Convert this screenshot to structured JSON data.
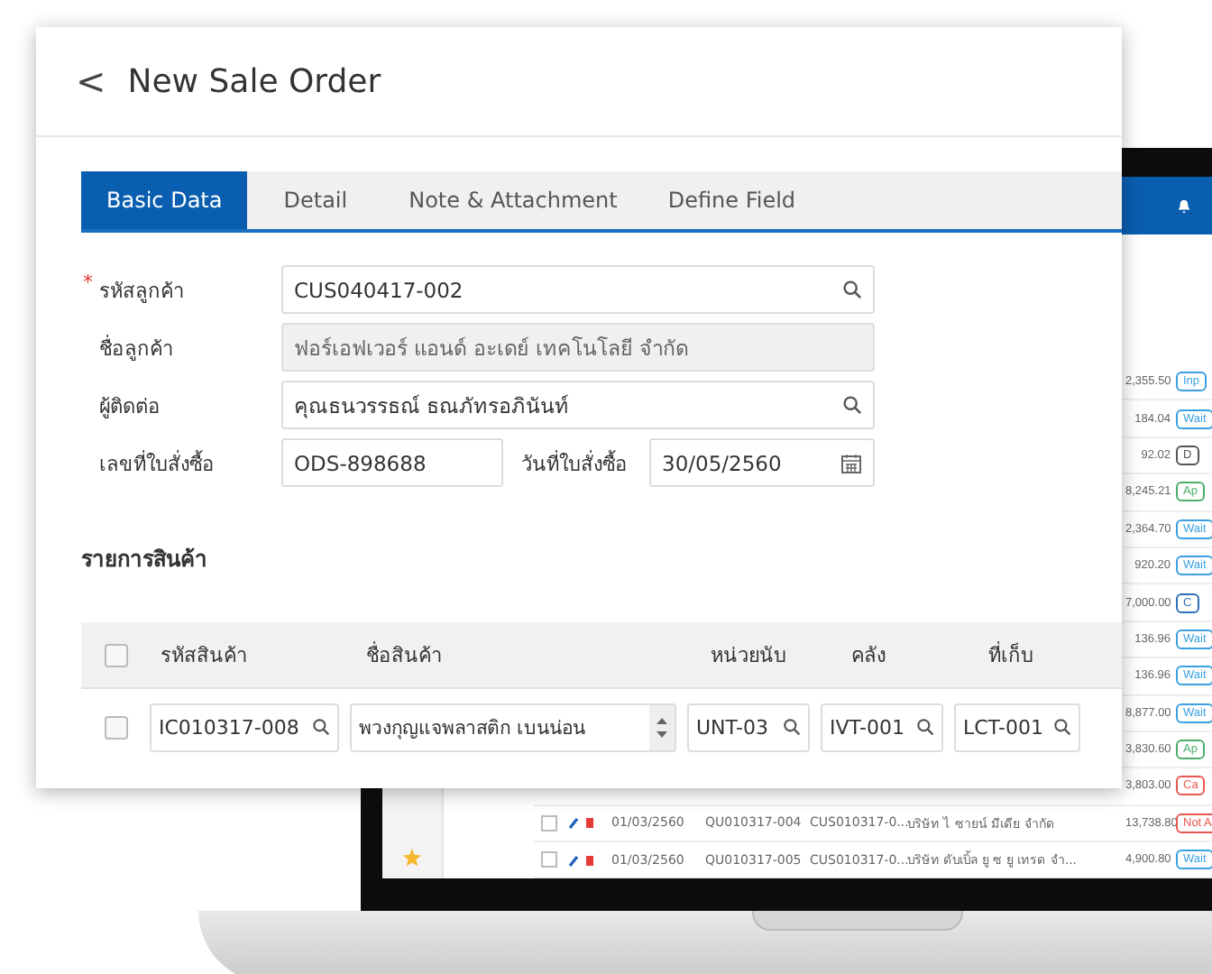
{
  "dialog": {
    "back": "<",
    "required_mark": "*",
    "title": "New Sale Order",
    "tabs": [
      {
        "label": "Basic Data",
        "selected": true
      },
      {
        "label": "Detail",
        "selected": false
      },
      {
        "label": "Note & Attachment",
        "selected": false
      },
      {
        "label": "Define Field",
        "selected": false
      }
    ],
    "fields": [
      {
        "label": "รหัสลูกค้า",
        "required": true,
        "value": "CUS040417-002",
        "kind": "lookup",
        "disabled": false
      },
      {
        "label": "ชื่อลูกค้า",
        "required": false,
        "value": "ฟอร์เอฟเวอร์ แอนด์ อะเดย์ เทคโนโลยี จำกัด",
        "kind": "text",
        "disabled": true
      },
      {
        "label": "ผู้ติดต่อ",
        "required": false,
        "value": "คุณธนวรรธณ์ ธณภัทรอภินันท์",
        "kind": "lookup",
        "disabled": false
      }
    ],
    "order_no": {
      "label": "เลขที่ใบสั่งซื้อ",
      "value": "ODS-898688"
    },
    "order_date": {
      "label": "วันที่ใบสั่งซื้อ",
      "value": "30/05/2560"
    },
    "items_title": "รายการสินค้า",
    "table": {
      "all_checked": false,
      "columns": [
        "รหัสสินค้า",
        "ชื่อสินค้า",
        "หน่วยนับ",
        "คลัง",
        "ที่เก็บ"
      ],
      "rows": [
        {
          "checked": false,
          "code": "IC010317-008",
          "name": "พวงกุญแจพลาสติก เบนน่อน",
          "unit": "UNT-03",
          "warehouse": "IVT-001",
          "location": "LCT-001"
        }
      ]
    }
  },
  "background_screen": {
    "rows": [
      {
        "amount": "2,355.50",
        "status": "Inp",
        "color": "#3aa0e0"
      },
      {
        "amount": "184.04",
        "status": "Wait",
        "color": "#3aa0e0"
      },
      {
        "amount": "92.02",
        "status": "D",
        "color": "#555555"
      },
      {
        "amount": "8,245.21",
        "status": "Ap",
        "color": "#4cae6c"
      },
      {
        "amount": "2,364.70",
        "status": "Wait",
        "color": "#3aa0e0"
      },
      {
        "amount": "920.20",
        "status": "Wait",
        "color": "#3aa0e0"
      },
      {
        "amount": "7,000.00",
        "status": "C",
        "color": "#2c6fb8"
      },
      {
        "amount": "136.96",
        "status": "Wait",
        "color": "#3aa0e0"
      },
      {
        "amount": "136.96",
        "status": "Wait",
        "color": "#3aa0e0"
      },
      {
        "amount": "8,877.00",
        "status": "Wait",
        "color": "#3aa0e0"
      },
      {
        "amount": "3,830.60",
        "status": "Ap",
        "color": "#4cae6c"
      },
      {
        "amount": "3,803.00",
        "status": "Ca",
        "color": "#e8574f"
      },
      {
        "checked": false,
        "date": "01/03/2560",
        "quote": "QU010317-004",
        "customer": "CUS010317-0...",
        "name": "บริษัท ไ ซายน์ มีเดีย จำกัด",
        "amount": "13,738.80",
        "status": "Not A",
        "color": "#e8574f"
      },
      {
        "checked": false,
        "date": "01/03/2560",
        "quote": "QU010317-005",
        "customer": "CUS010317-0...",
        "name": "บริษัท ดับเบิ้ล ยู ซ ยู เทรด จำ...",
        "amount": "4,900.80",
        "status": "Wait",
        "color": "#3aa0e0"
      }
    ]
  }
}
